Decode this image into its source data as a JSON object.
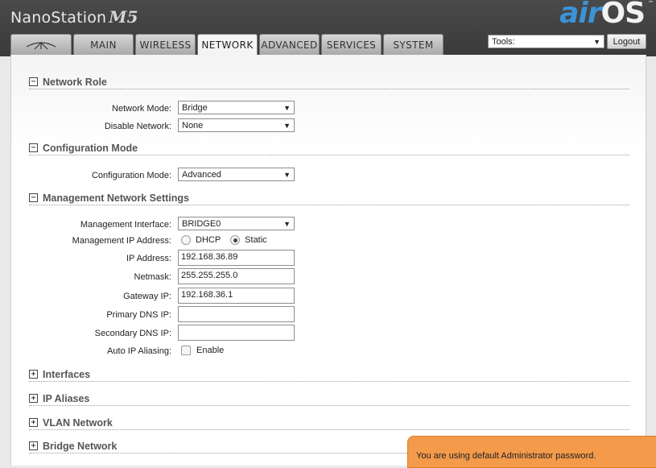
{
  "header": {
    "product": "NanoStation",
    "model": "M5",
    "brand_air": "air",
    "brand_os": "OS",
    "tm": "™"
  },
  "tabs": [
    {
      "label": "",
      "icon": "ubiquiti-logo-icon"
    },
    {
      "label": "MAIN"
    },
    {
      "label": "WIRELESS"
    },
    {
      "label": "NETWORK",
      "active": true
    },
    {
      "label": "ADVANCED"
    },
    {
      "label": "SERVICES"
    },
    {
      "label": "SYSTEM"
    }
  ],
  "tools": {
    "selected": "Tools:"
  },
  "logout_label": "Logout",
  "sections": {
    "network_role": {
      "title": "Network Role",
      "toggle": "−",
      "network_mode_label": "Network Mode:",
      "network_mode_value": "Bridge",
      "disable_network_label": "Disable Network:",
      "disable_network_value": "None"
    },
    "configuration_mode": {
      "title": "Configuration Mode",
      "toggle": "−",
      "config_mode_label": "Configuration Mode:",
      "config_mode_value": "Advanced"
    },
    "management": {
      "title": "Management Network Settings",
      "toggle": "−",
      "interface_label": "Management Interface:",
      "interface_value": "BRIDGE0",
      "ip_address_mode_label": "Management IP Address:",
      "dhcp_label": "DHCP",
      "static_label": "Static",
      "ip_label": "IP Address:",
      "ip_value": "192.168.36.89",
      "netmask_label": "Netmask:",
      "netmask_value": "255.255.255.0",
      "gateway_label": "Gateway IP:",
      "gateway_value": "192.168.36.1",
      "primary_dns_label": "Primary DNS IP:",
      "primary_dns_value": "",
      "secondary_dns_label": "Secondary DNS IP:",
      "secondary_dns_value": "",
      "auto_alias_label": "Auto IP Aliasing:",
      "enable_label": "Enable"
    },
    "collapsed": [
      {
        "title": "Interfaces",
        "toggle": "+"
      },
      {
        "title": "IP Aliases",
        "toggle": "+"
      },
      {
        "title": "VLAN Network",
        "toggle": "+"
      },
      {
        "title": "Bridge Network",
        "toggle": "+"
      }
    ]
  },
  "notice": "You are using default Administrator password.",
  "colors": {
    "accent_blue": "#3b93d6",
    "notice_orange": "#f39a4b",
    "header_bg": "#3f3f3f"
  }
}
